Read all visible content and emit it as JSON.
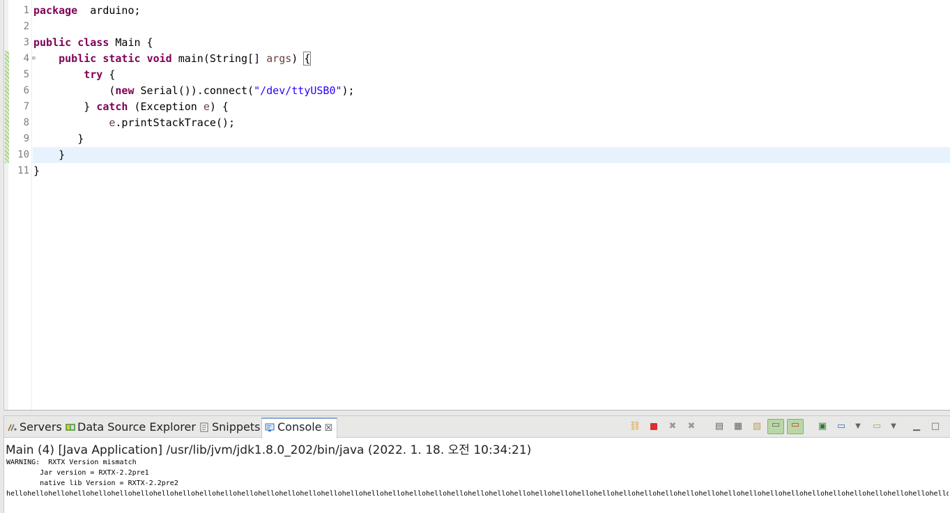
{
  "editor": {
    "lines": [
      {
        "num": "1",
        "parts": [
          [
            "kw",
            "package"
          ],
          [
            "",
            "  arduino;"
          ]
        ]
      },
      {
        "num": "2",
        "parts": []
      },
      {
        "num": "3",
        "parts": [
          [
            "kw",
            "public"
          ],
          [
            "",
            " "
          ],
          [
            "kw",
            "class"
          ],
          [
            "",
            " Main {"
          ]
        ]
      },
      {
        "num": "4",
        "fold": "⊖",
        "changed": true,
        "parts": [
          [
            "",
            "    "
          ],
          [
            "kw",
            "public"
          ],
          [
            "",
            " "
          ],
          [
            "kw",
            "static"
          ],
          [
            "",
            " "
          ],
          [
            "kw",
            "void"
          ],
          [
            "",
            " main(String[] "
          ],
          [
            "var",
            "args"
          ],
          [
            "",
            ") "
          ],
          [
            "bracket",
            "{"
          ]
        ]
      },
      {
        "num": "5",
        "changed": true,
        "parts": [
          [
            "",
            "        "
          ],
          [
            "kw",
            "try"
          ],
          [
            "",
            " {"
          ]
        ]
      },
      {
        "num": "6",
        "changed": true,
        "parts": [
          [
            "",
            "            ("
          ],
          [
            "kw",
            "new"
          ],
          [
            "",
            " Serial()).connect("
          ],
          [
            "str",
            "\"/dev/ttyUSB0\""
          ],
          [
            "",
            ");"
          ]
        ]
      },
      {
        "num": "7",
        "changed": true,
        "parts": [
          [
            "",
            "        } "
          ],
          [
            "kw",
            "catch"
          ],
          [
            "",
            " (Exception "
          ],
          [
            "var",
            "e"
          ],
          [
            "",
            ") {"
          ]
        ]
      },
      {
        "num": "8",
        "changed": true,
        "parts": [
          [
            "",
            "            "
          ],
          [
            "var",
            "e"
          ],
          [
            "",
            ".printStackTrace();"
          ]
        ]
      },
      {
        "num": "9",
        "changed": true,
        "parts": [
          [
            "",
            "       }"
          ]
        ]
      },
      {
        "num": "10",
        "changed": true,
        "current": true,
        "parts": [
          [
            "",
            "    }"
          ]
        ]
      },
      {
        "num": "11",
        "parts": [
          [
            "",
            "}"
          ]
        ]
      }
    ]
  },
  "panel": {
    "tabs": [
      {
        "label": "Servers",
        "icon": "servers-icon"
      },
      {
        "label": "Data Source Explorer",
        "icon": "data-source-explorer-icon"
      },
      {
        "label": "Snippets",
        "icon": "snippets-icon"
      },
      {
        "label": "Console",
        "icon": "console-icon",
        "active": true
      }
    ],
    "toolbar": [
      "link-icon",
      "terminate-icon",
      "remove-launch-icon",
      "remove-all-terminated-icon",
      "clear-console-icon",
      "scroll-lock-icon",
      "word-wrap-icon",
      "show-on-stdout-icon",
      "show-on-stderr-icon",
      "pin-console-icon",
      "display-console-icon",
      "open-console-icon",
      "minimize-icon",
      "maximize-icon"
    ],
    "launch_label": "Main (4) [Java Application] /usr/lib/jvm/jdk1.8.0_202/bin/java (2022. 1. 18. 오전 10:34:21)",
    "output": "WARNING:  RXTX Version mismatch\n\tJar version = RXTX-2.2pre1\n\tnative lib Version = RXTX-2.2pre2\nhellohellohellohellohellohellohellohellohellohellohellohellohellohellohellohellohellohellohellohellohellohellohellohellohellohellohellohellohellohellohellohellohellohellohellohellohellohellohellohellohellohellohellohellohellohellohellohellohellohellohellohellohellohellohellohellohellohellohellohellohellohellohello"
  },
  "colors": {
    "keyword": "#7f0055",
    "string": "#2a00ff",
    "variable": "#6a3e3e",
    "current_line": "#e8f2fe"
  }
}
